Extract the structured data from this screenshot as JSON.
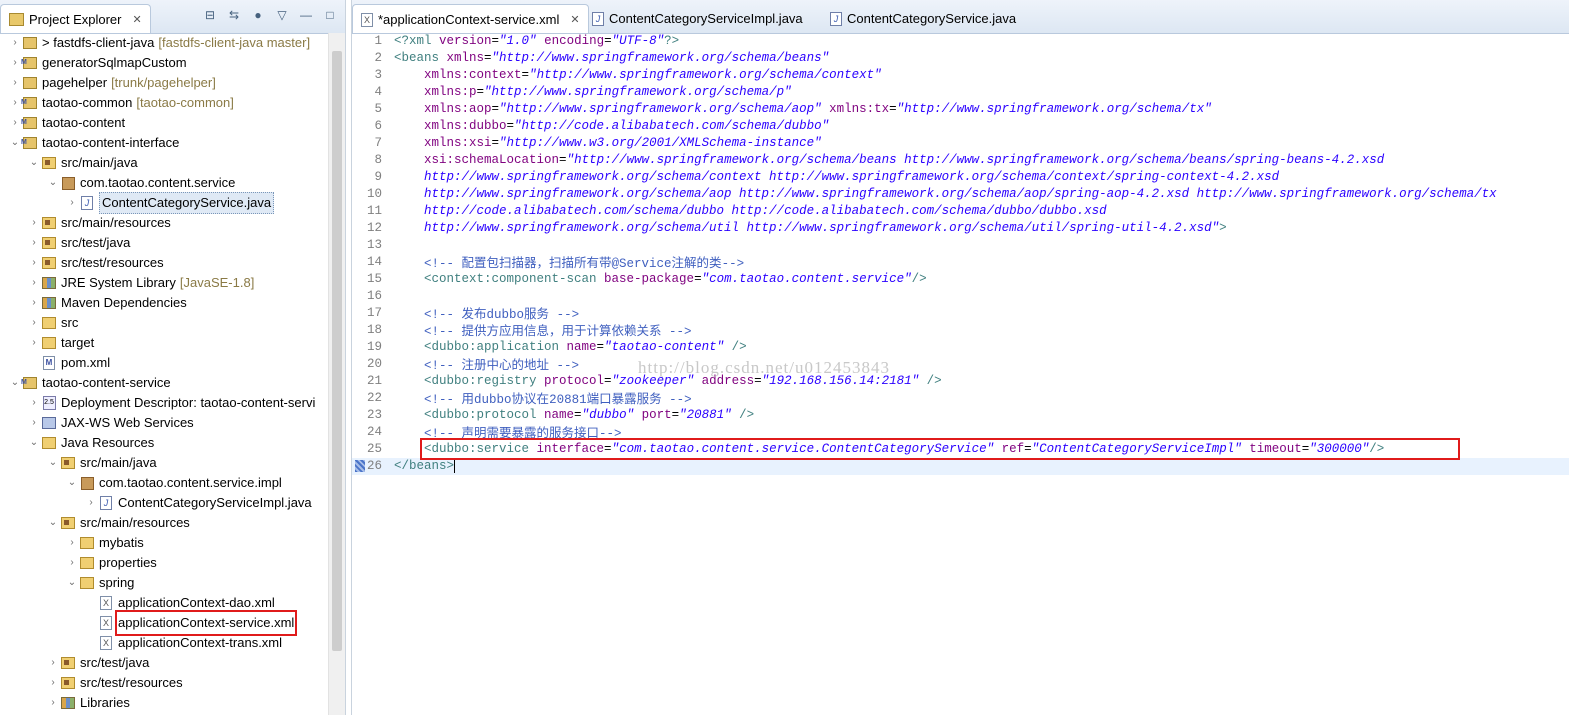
{
  "explorer": {
    "title": "Project Explorer",
    "close_glyph": "✕",
    "tree": [
      {
        "depth": 0,
        "twisty": "›",
        "icon": "project-icon",
        "label": "> fastdfs-client-java",
        "dec": "[fastdfs-client-java master]"
      },
      {
        "depth": 0,
        "twisty": "›",
        "icon": "maven-project-icon",
        "label": "generatorSqlmapCustom",
        "dec": ""
      },
      {
        "depth": 0,
        "twisty": "›",
        "icon": "project-icon",
        "label": "pagehelper",
        "dec": "[trunk/pagehelper]"
      },
      {
        "depth": 0,
        "twisty": "›",
        "icon": "maven-project-icon",
        "label": "taotao-common",
        "dec": "[taotao-common]"
      },
      {
        "depth": 0,
        "twisty": "›",
        "icon": "maven-project-icon",
        "label": "taotao-content",
        "dec": ""
      },
      {
        "depth": 0,
        "twisty": "⌄",
        "icon": "maven-project-icon",
        "label": "taotao-content-interface",
        "dec": ""
      },
      {
        "depth": 1,
        "twisty": "⌄",
        "icon": "source-folder-icon",
        "label": "src/main/java",
        "dec": ""
      },
      {
        "depth": 2,
        "twisty": "⌄",
        "icon": "package-icon",
        "label": "com.taotao.content.service",
        "dec": ""
      },
      {
        "depth": 3,
        "twisty": "›",
        "icon": "java-file-icon",
        "label": "ContentCategoryService.java",
        "dec": "",
        "selected": true
      },
      {
        "depth": 1,
        "twisty": "›",
        "icon": "source-folder-icon",
        "label": "src/main/resources",
        "dec": ""
      },
      {
        "depth": 1,
        "twisty": "›",
        "icon": "source-folder-icon",
        "label": "src/test/java",
        "dec": ""
      },
      {
        "depth": 1,
        "twisty": "›",
        "icon": "source-folder-icon",
        "label": "src/test/resources",
        "dec": ""
      },
      {
        "depth": 1,
        "twisty": "›",
        "icon": "library-icon",
        "label": "JRE System Library",
        "dec": "[JavaSE-1.8]"
      },
      {
        "depth": 1,
        "twisty": "›",
        "icon": "library-icon",
        "label": "Maven Dependencies",
        "dec": ""
      },
      {
        "depth": 1,
        "twisty": "›",
        "icon": "folder-icon",
        "label": "src",
        "dec": ""
      },
      {
        "depth": 1,
        "twisty": "›",
        "icon": "folder-icon",
        "label": "target",
        "dec": ""
      },
      {
        "depth": 1,
        "twisty": "",
        "icon": "pom-file-icon",
        "label": "pom.xml",
        "dec": ""
      },
      {
        "depth": 0,
        "twisty": "⌄",
        "icon": "maven-project-icon",
        "label": "taotao-content-service",
        "dec": ""
      },
      {
        "depth": 1,
        "twisty": "›",
        "icon": "deployment-descriptor-icon",
        "label": "Deployment Descriptor: taotao-content-servi",
        "dec": ""
      },
      {
        "depth": 1,
        "twisty": "›",
        "icon": "web-service-icon",
        "label": "JAX-WS Web Services",
        "dec": ""
      },
      {
        "depth": 1,
        "twisty": "⌄",
        "icon": "java-resources-icon",
        "label": "Java Resources",
        "dec": ""
      },
      {
        "depth": 2,
        "twisty": "⌄",
        "icon": "source-folder-icon",
        "label": "src/main/java",
        "dec": ""
      },
      {
        "depth": 3,
        "twisty": "⌄",
        "icon": "package-icon",
        "label": "com.taotao.content.service.impl",
        "dec": ""
      },
      {
        "depth": 4,
        "twisty": "›",
        "icon": "java-file-icon",
        "label": "ContentCategoryServiceImpl.java",
        "dec": ""
      },
      {
        "depth": 2,
        "twisty": "⌄",
        "icon": "source-folder-icon",
        "label": "src/main/resources",
        "dec": ""
      },
      {
        "depth": 3,
        "twisty": "›",
        "icon": "folder-icon",
        "label": "mybatis",
        "dec": ""
      },
      {
        "depth": 3,
        "twisty": "›",
        "icon": "folder-icon",
        "label": "properties",
        "dec": ""
      },
      {
        "depth": 3,
        "twisty": "⌄",
        "icon": "folder-icon",
        "label": "spring",
        "dec": ""
      },
      {
        "depth": 4,
        "twisty": "",
        "icon": "xml-file-icon",
        "label": "applicationContext-dao.xml",
        "dec": ""
      },
      {
        "depth": 4,
        "twisty": "",
        "icon": "xml-file-icon",
        "label": "applicationContext-service.xml",
        "dec": "",
        "highlight": true
      },
      {
        "depth": 4,
        "twisty": "",
        "icon": "xml-file-icon",
        "label": "applicationContext-trans.xml",
        "dec": ""
      },
      {
        "depth": 2,
        "twisty": "›",
        "icon": "source-folder-icon",
        "label": "src/test/java",
        "dec": ""
      },
      {
        "depth": 2,
        "twisty": "›",
        "icon": "source-folder-icon",
        "label": "src/test/resources",
        "dec": ""
      },
      {
        "depth": 2,
        "twisty": "›",
        "icon": "library-icon",
        "label": "Libraries",
        "dec": ""
      }
    ]
  },
  "editor": {
    "tabs": [
      {
        "label": "*applicationContext-service.xml",
        "icon": "xml-file-icon",
        "active": true,
        "close": "✕"
      },
      {
        "label": "ContentCategoryServiceImpl.java",
        "icon": "java-file-icon",
        "active": false,
        "close": ""
      },
      {
        "label": "ContentCategoryService.java",
        "icon": "java-file-icon",
        "active": false,
        "close": ""
      }
    ],
    "watermark": "http://blog.csdn.net/u012453843",
    "lines": [
      {
        "n": "1",
        "parts": [
          [
            "pi",
            "<?xml "
          ],
          [
            "attr",
            "version"
          ],
          [
            "t",
            "="
          ],
          [
            "val",
            "\"1.0\""
          ],
          [
            "t",
            " "
          ],
          [
            "attr",
            "encoding"
          ],
          [
            "t",
            "="
          ],
          [
            "val",
            "\"UTF-8\""
          ],
          [
            "pi",
            "?>"
          ]
        ]
      },
      {
        "n": "2",
        "parts": [
          [
            "tag",
            "<beans "
          ],
          [
            "attr",
            "xmlns"
          ],
          [
            "t",
            "="
          ],
          [
            "val",
            "\"http://www.springframework.org/schema/beans\""
          ]
        ]
      },
      {
        "n": "3",
        "parts": [
          [
            "t",
            "    "
          ],
          [
            "attr",
            "xmlns:context"
          ],
          [
            "t",
            "="
          ],
          [
            "val",
            "\"http://www.springframework.org/schema/context\""
          ]
        ]
      },
      {
        "n": "4",
        "parts": [
          [
            "t",
            "    "
          ],
          [
            "attr",
            "xmlns:p"
          ],
          [
            "t",
            "="
          ],
          [
            "val",
            "\"http://www.springframework.org/schema/p\""
          ]
        ]
      },
      {
        "n": "5",
        "parts": [
          [
            "t",
            "    "
          ],
          [
            "attr",
            "xmlns:aop"
          ],
          [
            "t",
            "="
          ],
          [
            "val",
            "\"http://www.springframework.org/schema/aop\""
          ],
          [
            "t",
            " "
          ],
          [
            "attr",
            "xmlns:tx"
          ],
          [
            "t",
            "="
          ],
          [
            "val",
            "\"http://www.springframework.org/schema/tx\""
          ]
        ]
      },
      {
        "n": "6",
        "parts": [
          [
            "t",
            "    "
          ],
          [
            "attr",
            "xmlns:dubbo"
          ],
          [
            "t",
            "="
          ],
          [
            "val",
            "\"http://code.alibabatech.com/schema/dubbo\""
          ]
        ]
      },
      {
        "n": "7",
        "parts": [
          [
            "t",
            "    "
          ],
          [
            "attr",
            "xmlns:xsi"
          ],
          [
            "t",
            "="
          ],
          [
            "val",
            "\"http://www.w3.org/2001/XMLSchema-instance\""
          ]
        ]
      },
      {
        "n": "8",
        "parts": [
          [
            "t",
            "    "
          ],
          [
            "attr",
            "xsi:schemaLocation"
          ],
          [
            "t",
            "="
          ],
          [
            "val",
            "\"http://www.springframework.org/schema/beans http://www.springframework.org/schema/beans/spring-beans-4.2.xsd"
          ]
        ]
      },
      {
        "n": "9",
        "parts": [
          [
            "val",
            "    http://www.springframework.org/schema/context http://www.springframework.org/schema/context/spring-context-4.2.xsd"
          ]
        ]
      },
      {
        "n": "10",
        "parts": [
          [
            "val",
            "    http://www.springframework.org/schema/aop http://www.springframework.org/schema/aop/spring-aop-4.2.xsd http://www.springframework.org/schema/tx"
          ]
        ]
      },
      {
        "n": "11",
        "parts": [
          [
            "val",
            "    http://code.alibabatech.com/schema/dubbo http://code.alibabatech.com/schema/dubbo/dubbo.xsd"
          ]
        ]
      },
      {
        "n": "12",
        "parts": [
          [
            "val",
            "    http://www.springframework.org/schema/util http://www.springframework.org/schema/util/spring-util-4.2.xsd\""
          ],
          [
            "tag",
            ">"
          ]
        ]
      },
      {
        "n": "13",
        "parts": []
      },
      {
        "n": "14",
        "parts": [
          [
            "cmt",
            "    <!-- "
          ],
          [
            "cmtcn",
            "配置包扫描器，扫描所有带"
          ],
          [
            "cmt",
            "@Service"
          ],
          [
            "cmtcn",
            "注解的类"
          ],
          [
            "cmt",
            "-->"
          ]
        ]
      },
      {
        "n": "15",
        "parts": [
          [
            "tag",
            "    <context:component-scan "
          ],
          [
            "attr",
            "base-package"
          ],
          [
            "t",
            "="
          ],
          [
            "val",
            "\"com.taotao.content.service\""
          ],
          [
            "tag",
            "/>"
          ]
        ]
      },
      {
        "n": "16",
        "parts": []
      },
      {
        "n": "17",
        "parts": [
          [
            "cmt",
            "    <!-- "
          ],
          [
            "cmtcn",
            "发布"
          ],
          [
            "cmt",
            "dubbo"
          ],
          [
            "cmtcn",
            "服务"
          ],
          [
            "cmt",
            " -->"
          ]
        ]
      },
      {
        "n": "18",
        "parts": [
          [
            "cmt",
            "    <!-- "
          ],
          [
            "cmtcn",
            "提供方应用信息，用于计算依赖关系"
          ],
          [
            "cmt",
            " -->"
          ]
        ]
      },
      {
        "n": "19",
        "parts": [
          [
            "tag",
            "    <dubbo:application "
          ],
          [
            "attr",
            "name"
          ],
          [
            "t",
            "="
          ],
          [
            "val",
            "\"taotao-content\""
          ],
          [
            "tag",
            " />"
          ]
        ]
      },
      {
        "n": "20",
        "parts": [
          [
            "cmt",
            "    <!-- "
          ],
          [
            "cmtcn",
            "注册中心的地址"
          ],
          [
            "cmt",
            " -->"
          ]
        ]
      },
      {
        "n": "21",
        "parts": [
          [
            "tag",
            "    <dubbo:registry "
          ],
          [
            "attr",
            "protocol"
          ],
          [
            "t",
            "="
          ],
          [
            "val",
            "\"zookeeper\""
          ],
          [
            "t",
            " "
          ],
          [
            "attr",
            "address"
          ],
          [
            "t",
            "="
          ],
          [
            "val",
            "\"192.168.156.14:2181\""
          ],
          [
            "tag",
            " />"
          ]
        ]
      },
      {
        "n": "22",
        "parts": [
          [
            "cmt",
            "    <!-- "
          ],
          [
            "cmtcn",
            "用"
          ],
          [
            "cmt",
            "dubbo"
          ],
          [
            "cmtcn",
            "协议在"
          ],
          [
            "cmt",
            "20881"
          ],
          [
            "cmtcn",
            "端口暴露服务"
          ],
          [
            "cmt",
            " -->"
          ]
        ]
      },
      {
        "n": "23",
        "parts": [
          [
            "tag",
            "    <dubbo:protocol "
          ],
          [
            "attr",
            "name"
          ],
          [
            "t",
            "="
          ],
          [
            "val",
            "\"dubbo\""
          ],
          [
            "t",
            " "
          ],
          [
            "attr",
            "port"
          ],
          [
            "t",
            "="
          ],
          [
            "val",
            "\"20881\""
          ],
          [
            "tag",
            " />"
          ]
        ]
      },
      {
        "n": "24",
        "parts": [
          [
            "cmt",
            "    <!-- "
          ],
          [
            "cmtcn",
            "声明需要暴露的服务接口"
          ],
          [
            "cmt",
            "-->"
          ]
        ]
      },
      {
        "n": "25",
        "parts": [
          [
            "tag",
            "    <dubbo:service "
          ],
          [
            "attr",
            "interface"
          ],
          [
            "t",
            "="
          ],
          [
            "val",
            "\"com.taotao.content.service.ContentCategoryService\""
          ],
          [
            "t",
            " "
          ],
          [
            "attr",
            "ref"
          ],
          [
            "t",
            "="
          ],
          [
            "val",
            "\"ContentCategoryServiceImpl\""
          ],
          [
            "t",
            " "
          ],
          [
            "attr",
            "timeout"
          ],
          [
            "t",
            "="
          ],
          [
            "val",
            "\"300000\""
          ],
          [
            "tag",
            "/>"
          ]
        ]
      },
      {
        "n": "26",
        "parts": [
          [
            "tag",
            "</beans>"
          ]
        ],
        "current": true
      }
    ]
  }
}
